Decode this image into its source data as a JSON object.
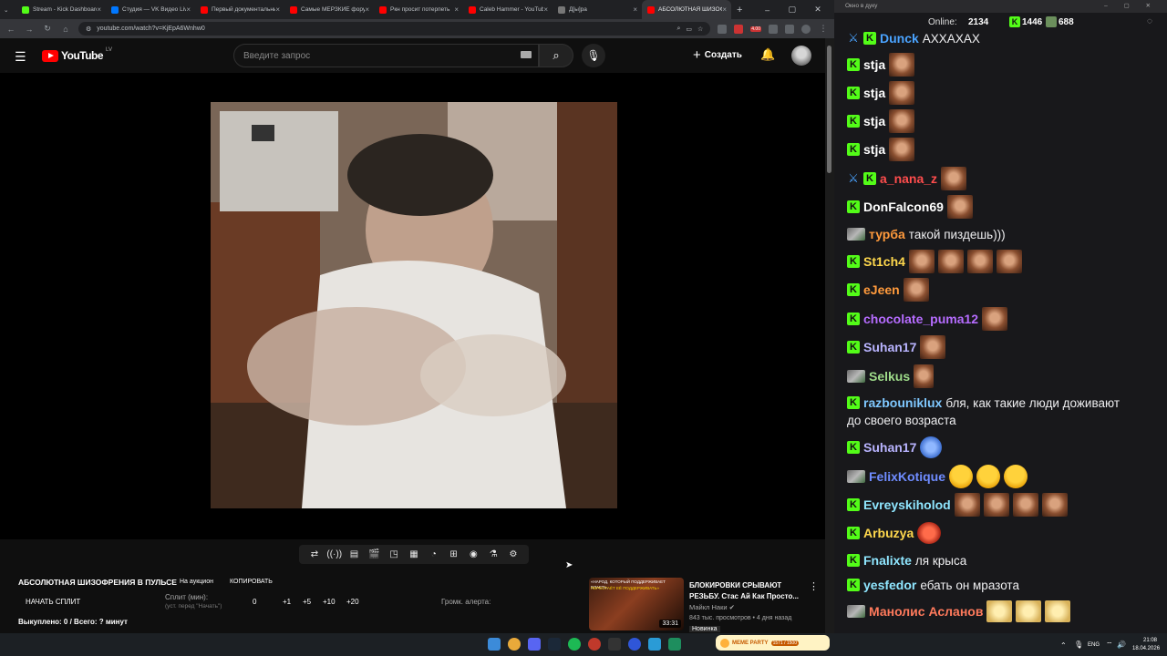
{
  "browser": {
    "tabs": [
      {
        "title": "Stream - Kick Dashboard",
        "color": "#53fc18"
      },
      {
        "title": "Студия — VK Видео Live",
        "color": "#0077ff"
      },
      {
        "title": "Первый документальный",
        "color": "#ff0000"
      },
      {
        "title": "Самые МЕРЗКИЕ фору",
        "color": "#ff0000"
      },
      {
        "title": "Ркн просит потерпеть",
        "color": "#ff0000"
      },
      {
        "title": "Caleb Hammer - YouTube",
        "color": "#ff0000"
      },
      {
        "title": "Д[ы]ра",
        "color": "#777777"
      },
      {
        "title": "АБСОЛЮТНАЯ ШИЗОФ",
        "color": "#ff0000",
        "active": true
      }
    ],
    "url": "youtube.com/watch?v=KjEpA6Wnhw0",
    "ext_badge": "4.00"
  },
  "youtube": {
    "logo_text": "YouTube",
    "country": "LV",
    "search_placeholder": "Введите запрос",
    "create_label": "Создать"
  },
  "panel": {
    "title": "АБСОЛЮТНАЯ ШИЗОФРЕНИЯ В ПУЛЬСЕ",
    "auction": "На аукцион",
    "copy": "КОПИРОВАТЬ",
    "split_start": "НАЧАТЬ СПЛИТ",
    "split_label": "Сплит (мин):",
    "split_hint": "(уст. перед \"Начать\")",
    "split_value": "0",
    "steps": [
      "+1",
      "+5",
      "+10",
      "+20"
    ],
    "alert_volume": "Громк. алерта:",
    "bought": "Выкуплено: 0 / Всего: ? минут"
  },
  "recommendation": {
    "title": "БЛОКИРОВКИ СРЫВАЮТ РЕЗЬБУ. Стас Ай Как Просто...",
    "channel": "Майкл Наки",
    "meta": "843 тыс. просмотров • 4 дня назад",
    "badge": "Новинка",
    "duration": "33:31",
    "thumb_caption": "«НАРОД, КОТОРЫЙ ПОДДЕРЖИВАЕТ ВЛАСТЬ,",
    "thumb_caption2": "ПЕРЕСТАЁТ ЕЁ ПОДДЕРЖИВАТЬ»"
  },
  "chat": {
    "window_title": "Окно в дуку",
    "online_label": "Online:",
    "online_count": "2134",
    "kick_count": "1446",
    "other_count": "688",
    "messages": [
      {
        "nick": "Dunck",
        "color": "#4aa3ff",
        "text": "АХХАХАХ",
        "mod": true
      },
      {
        "nick": "stja",
        "color": "#ffffff",
        "text": ""
      },
      {
        "nick": "stja",
        "color": "#ffffff",
        "text": ""
      },
      {
        "nick": "stja",
        "color": "#ffffff",
        "text": ""
      },
      {
        "nick": "stja",
        "color": "#ffffff",
        "text": ""
      },
      {
        "nick": "a_nana_z",
        "color": "#ff4d4d",
        "text": "",
        "mod": true
      },
      {
        "nick": "DonFalcon69",
        "color": "#ffffff",
        "text": ""
      },
      {
        "nick": "турба",
        "color": "#ff9a3c",
        "text": "такой пиздешь)))"
      },
      {
        "nick": "St1ch4",
        "color": "#ffd84d",
        "text": ""
      },
      {
        "nick": "eJeen",
        "color": "#ff9a3c",
        "text": ""
      },
      {
        "nick": "chocolate_puma12",
        "color": "#b66cff",
        "text": ""
      },
      {
        "nick": "Suhan17",
        "color": "#b9b4ff",
        "text": ""
      },
      {
        "nick": "Selkus",
        "color": "#9fdc8a",
        "text": ""
      },
      {
        "nick": "razbouniklux",
        "color": "#7fc8ff",
        "text": "бля, как такие люди доживают",
        "text2": "до своего возраста"
      },
      {
        "nick": "Suhan17",
        "color": "#b9b4ff",
        "text": ""
      },
      {
        "nick": "FelixKotique",
        "color": "#6f8cff",
        "text": ""
      },
      {
        "nick": "Evreyskiholod",
        "color": "#8fe6ff",
        "text": ""
      },
      {
        "nick": "Arbuzya",
        "color": "#ffd84d",
        "text": ""
      },
      {
        "nick": "Fnalixte",
        "color": "#8fe6ff",
        "text": "ля крыса"
      },
      {
        "nick": "yesfedor",
        "color": "#8fe6ff",
        "text": "ебать он мразота"
      },
      {
        "nick": "Манолис Асланов",
        "color": "#ff7a5c",
        "text": ""
      }
    ]
  },
  "taskbar": {
    "lang": "ENG",
    "time": "21:08",
    "date": "18.04.2026",
    "meme_label": "MEME PARTY",
    "meme_progress": "1571 / 1500"
  }
}
